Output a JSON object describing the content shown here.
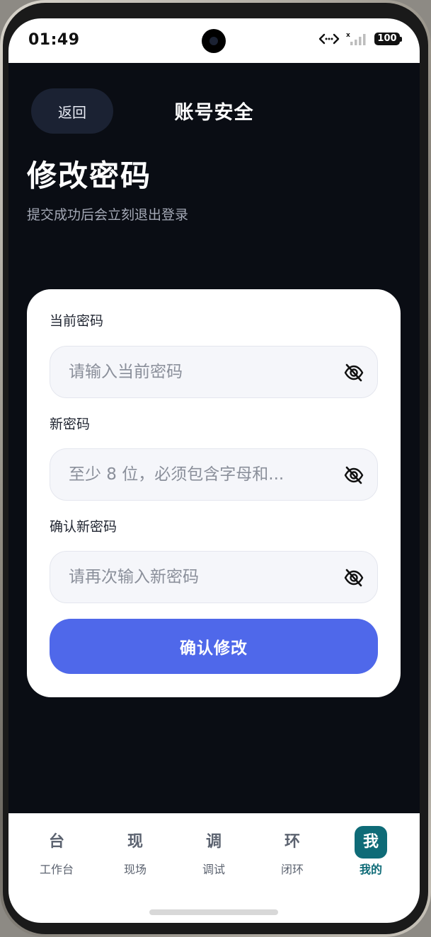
{
  "status_bar": {
    "time": "01:49",
    "battery": "100"
  },
  "header": {
    "back_label": "返回",
    "title": "账号安全"
  },
  "page": {
    "title": "修改密码",
    "subtitle": "提交成功后会立刻退出登录"
  },
  "form": {
    "current_password": {
      "label": "当前密码",
      "placeholder": "请输入当前密码",
      "value": ""
    },
    "new_password": {
      "label": "新密码",
      "placeholder": "至少 8 位，必须包含字母和...",
      "value": ""
    },
    "confirm_password": {
      "label": "确认新密码",
      "placeholder": "请再次输入新密码",
      "value": ""
    },
    "submit_label": "确认修改"
  },
  "tabbar": {
    "items": [
      {
        "glyph": "台",
        "label": "工作台"
      },
      {
        "glyph": "现",
        "label": "现场"
      },
      {
        "glyph": "调",
        "label": "调试"
      },
      {
        "glyph": "环",
        "label": "闭环"
      },
      {
        "glyph": "我",
        "label": "我的"
      }
    ],
    "active_index": 4
  },
  "colors": {
    "background": "#0a0d14",
    "accent": "#4f68ea",
    "active_tab": "#0e6b77"
  }
}
